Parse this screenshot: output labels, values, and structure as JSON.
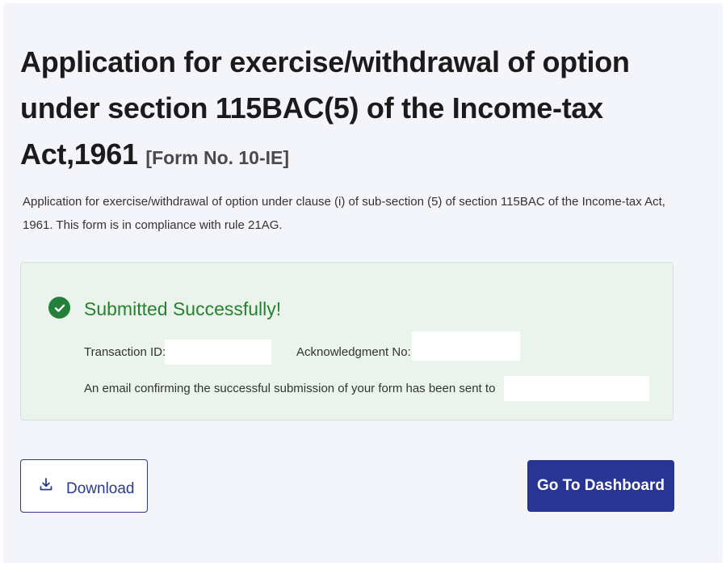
{
  "header": {
    "title": "Application for exercise/withdrawal of option under section 115BAC(5) of the Income-tax Act,1961",
    "form_no": "[Form No. 10-IE]"
  },
  "description": "Application for exercise/withdrawal of option under clause (i) of sub-section (5) of section 115BAC of the Income-tax Act, 1961. This form is in compliance with rule 21AG.",
  "success": {
    "icon": "check-circle-icon",
    "title": "Submitted Successfully!",
    "transaction_id_label": "Transaction ID:",
    "transaction_id_value": "",
    "acknowledgment_no_label": "Acknowledgment No:",
    "acknowledgment_no_value": "",
    "email_message": "An email confirming the successful submission of your form has been sent to",
    "email_value": "",
    "color": "#25832f"
  },
  "actions": {
    "download_label": "Download",
    "download_icon": "download-icon",
    "dashboard_label": "Go To Dashboard"
  },
  "colors": {
    "primary": "#283593",
    "success_bg": "#ebf4ec",
    "page_bg": "#f4f5fa"
  }
}
